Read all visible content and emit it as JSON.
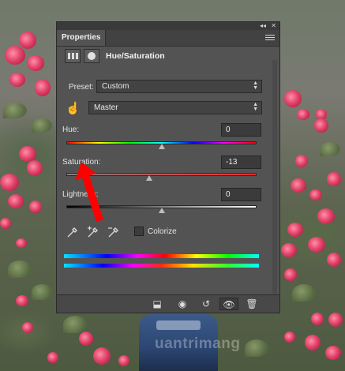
{
  "panel": {
    "tab_title": "Properties",
    "adjustment_title": "Hue/Saturation",
    "collapse_glyph": "◂◂",
    "close_glyph": "✕",
    "preset": {
      "label": "Preset:",
      "value": "Custom"
    },
    "channel": {
      "value": "Master"
    },
    "hue": {
      "label": "Hue:",
      "value": "0"
    },
    "saturation": {
      "label": "Saturation:",
      "value": "-13"
    },
    "lightness": {
      "label": "Lightness:",
      "value": "0"
    },
    "colorize_label": "Colorize",
    "icons": {
      "header_adjustment": "hue-saturation-icon",
      "header_mask": "layer-mask-icon",
      "targeted_adjustment": "hand-tool-icon",
      "eyedroppers": [
        "eyedropper-icon",
        "eyedropper-plus-icon",
        "eyedropper-minus-icon"
      ],
      "footer": [
        "clip-to-layer-icon",
        "view-previous-state-icon",
        "reset-icon",
        "toggle-visibility-icon",
        "delete-icon"
      ]
    }
  },
  "watermark": "uantrimang",
  "annotation": {
    "arrow_color": "#ff0000"
  }
}
